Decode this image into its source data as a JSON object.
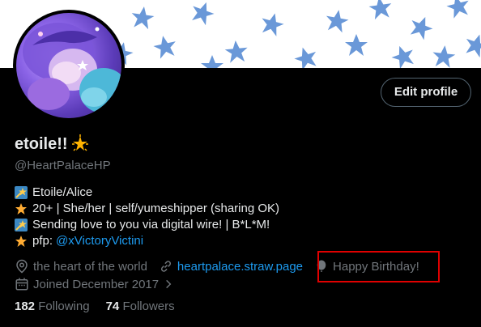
{
  "profile": {
    "display_name": "etoile!!",
    "handle": "@HeartPalaceHP",
    "edit_profile_label": "Edit profile"
  },
  "bio": {
    "line1": "Etoile/Alice",
    "line2": "20+ | She/her | self/yumeshipper (sharing OK)",
    "line3": "Sending love to you via digital wire! | B*L*M!",
    "line4_prefix": "pfp:",
    "line4_link": "@xVictoryVictini"
  },
  "meta": {
    "location": "the heart of the world",
    "website": "heartpalace.straw.page",
    "birthday": "Happy Birthday!",
    "joined": "Joined December 2017"
  },
  "stats": {
    "following_count": "182",
    "following_label": "Following",
    "followers_count": "74",
    "followers_label": "Followers"
  },
  "icons": {
    "location": "map-pin-icon",
    "website": "link-icon",
    "birthday": "balloon-icon",
    "joined": "calendar-icon",
    "joined_chevron": "chevron-right-icon"
  },
  "colors": {
    "background": "#000000",
    "link": "#1d9bf0",
    "secondary_text": "#71767b",
    "highlight_box": "#e00000",
    "banner_star": "#5b8fd6"
  }
}
